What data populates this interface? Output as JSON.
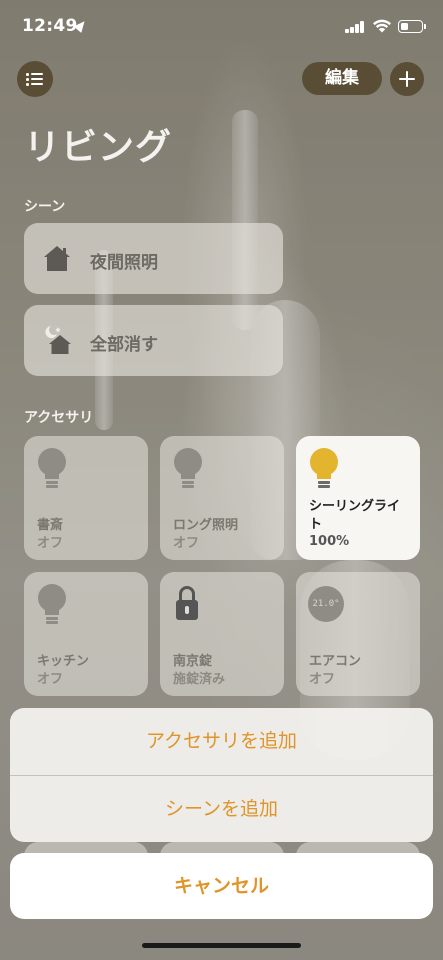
{
  "status_bar": {
    "time": "12:49"
  },
  "header": {
    "edit_label": "編集",
    "room_title": "リビング"
  },
  "scenes": {
    "section_title": "シーン",
    "items": [
      {
        "label": "夜間照明",
        "icon": "house-icon"
      },
      {
        "label": "全部消す",
        "icon": "house-moon-icon"
      }
    ]
  },
  "accessories": {
    "section_title": "アクセサリ",
    "items": [
      {
        "name": "書斎",
        "state": "オフ",
        "icon": "lightbulb-icon",
        "on": false
      },
      {
        "name": "ロング照明",
        "state": "オフ",
        "icon": "lightbulb-icon",
        "on": false
      },
      {
        "name": "シーリングライト",
        "state": "100%",
        "icon": "lightbulb-icon",
        "on": true
      },
      {
        "name": "キッチン",
        "state": "オフ",
        "icon": "lightbulb-icon",
        "on": false
      },
      {
        "name": "南京錠",
        "state": "施錠済み",
        "icon": "lock-icon",
        "on": false
      },
      {
        "name": "エアコン",
        "state": "オフ",
        "icon": "thermostat-icon",
        "on": false,
        "temperature": "21.0°"
      }
    ]
  },
  "action_sheet": {
    "options": [
      "アクセサリを追加",
      "シーンを追加"
    ],
    "cancel_label": "キャンセル"
  },
  "colors": {
    "accent": "#e0952a",
    "header_button_bg": "#5a4d35",
    "bulb_on": "#e3b52f"
  }
}
